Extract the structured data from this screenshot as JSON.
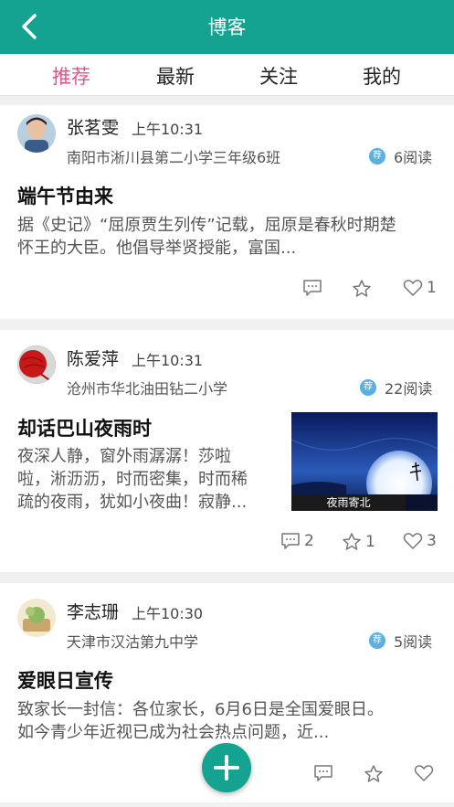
{
  "header": {
    "title": "博客",
    "back_icon": "chevron-left-icon"
  },
  "tabs": [
    {
      "label": "推荐",
      "active": true
    },
    {
      "label": "最新",
      "active": false
    },
    {
      "label": "关注",
      "active": false
    },
    {
      "label": "我的",
      "active": false
    }
  ],
  "posts": [
    {
      "author": "张茗雯",
      "time": "上午10:31",
      "school": "南阳市淅川县第二小学三年级6班",
      "badge": "荐",
      "reads": "6阅读",
      "title": "端午节由来",
      "summary_lines": [
        "据《史记》“屈原贾生列传”记载，屈原是春秋时期楚",
        "怀王的大臣。他倡导举贤授能，富国..."
      ],
      "comments": "",
      "likes": "",
      "hearts": "1"
    },
    {
      "author": "陈爱萍",
      "time": "上午10:31",
      "school": "沧州市华北油田钻二小学",
      "badge": "荐",
      "reads": "22阅读",
      "title": "却话巴山夜雨时",
      "summary_lines": [
        "夜深人静，窗外雨潺潺！莎啦",
        "啦，淅沥沥，时而密集，时而稀",
        "疏的夜雨，犹如小夜曲！寂静..."
      ],
      "image_caption": "夜雨寄北",
      "comments": "2",
      "likes": "1",
      "hearts": "3"
    },
    {
      "author": "李志珊",
      "time": "上午10:30",
      "school": "天津市汉沽第九中学",
      "badge": "荐",
      "reads": "5阅读",
      "title": "爱眼日宣传",
      "summary_lines": [
        "致家长一封信：各位家长，6月6日是全国爱眼日。",
        "如今青少年近视已成为社会热点问题，近..."
      ],
      "comments": "",
      "likes": "",
      "hearts": ""
    }
  ],
  "fab": {
    "icon": "plus-icon"
  },
  "colors": {
    "primary": "#13a390",
    "active_tab": "#e9508b",
    "badge": "#5ab0e0"
  }
}
